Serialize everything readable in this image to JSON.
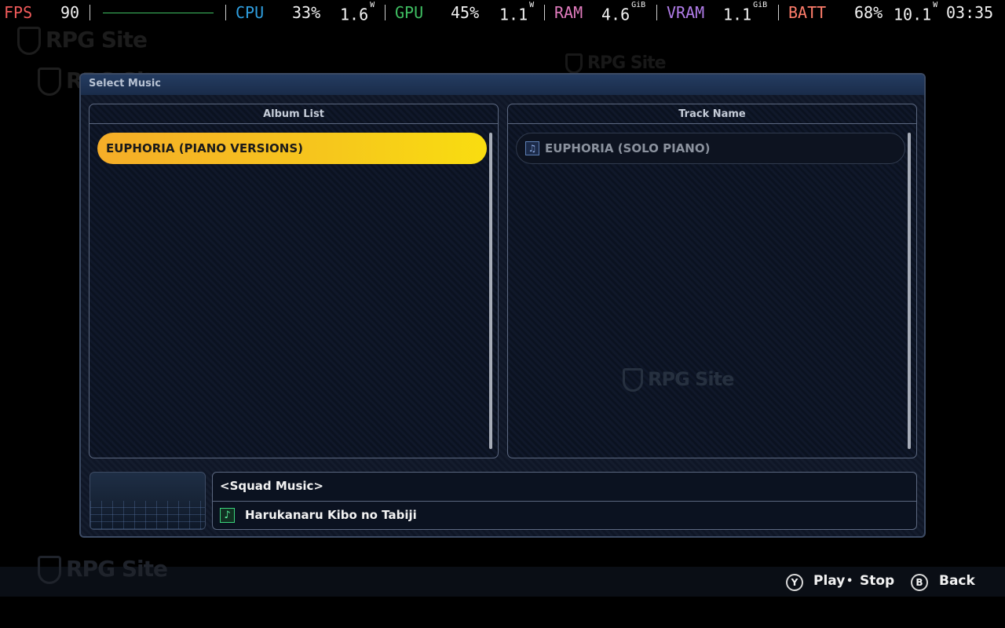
{
  "overlay": {
    "fps_label": "FPS",
    "fps_value": "90",
    "cpu_label": "CPU",
    "cpu_usage": "33%",
    "cpu_power": "1.6",
    "cpu_power_unit": "W",
    "gpu_label": "GPU",
    "gpu_usage": "45%",
    "gpu_power": "1.1",
    "gpu_power_unit": "W",
    "ram_label": "RAM",
    "ram_value": "4.6",
    "ram_unit": "GiB",
    "vram_label": "VRAM",
    "vram_value": "1.1",
    "vram_unit": "GiB",
    "batt_label": "BATT",
    "batt_percent": "68%",
    "batt_power": "10.1",
    "batt_power_unit": "W",
    "time": "03:35",
    "colors": {
      "fps": "#ef5a5a",
      "cpu": "#2f9fe0",
      "gpu": "#3fbf62",
      "ram": "#e07bbd",
      "vram": "#b07ce8",
      "batt": "#ff7d6b"
    }
  },
  "watermark": {
    "text": "RPG Site"
  },
  "dialog": {
    "title": "Select Music",
    "album_header": "Album List",
    "track_header": "Track Name",
    "albums": [
      {
        "label": "EUPHORIA (PIANO VERSIONS)",
        "selected": true
      }
    ],
    "tracks": [
      {
        "label": "EUPHORIA (SOLO PIANO)",
        "icon": "music-file-icon"
      }
    ],
    "now_playing": {
      "category": "<Squad Music>",
      "song": "Harukanaru Kibo no Tabiji",
      "icon": "music-note-icon"
    }
  },
  "footer": {
    "y_button": "Y",
    "play_label": "Play",
    "separator": "•",
    "stop_label": "Stop",
    "b_button": "B",
    "back_label": "Back"
  }
}
